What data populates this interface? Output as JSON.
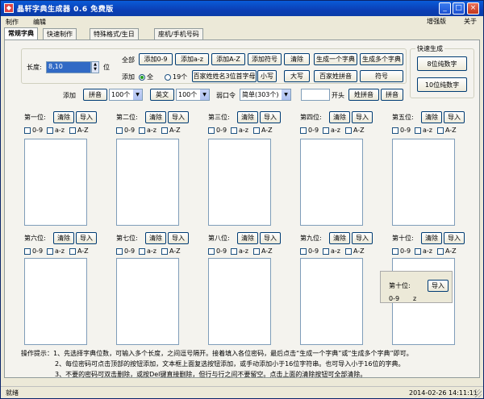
{
  "window": {
    "title": "晶轩字典生成器 0.6 免费版",
    "minimize": "_",
    "maximize": "□",
    "close": "×"
  },
  "menu": {
    "items": [
      "制作",
      "编辑"
    ],
    "right": [
      "增强版",
      "关于"
    ]
  },
  "tabs": [
    "常规字典",
    "快速制作",
    "特殊格式/生日",
    "座机/手机号码"
  ],
  "length": {
    "label": "长度:",
    "value": "8,10",
    "unit": "位"
  },
  "all_label": "全部",
  "add_buttons": [
    "添加0-9",
    "添加a-z",
    "添加A-Z",
    "添加符号",
    "清除"
  ],
  "generate_one": "生成一个字典",
  "generate_multi": "生成多个字典",
  "row2": {
    "add_label": "添加",
    "radio_all": "全",
    "radio_19": "19个",
    "surname_btn": "百家姓姓名3位首字母",
    "small_btn": "小写",
    "big_btn": "大写",
    "surname_pinyin": "百家姓拼音",
    "symbol_btn": "符号"
  },
  "row3": {
    "add_label": "添加",
    "pinyin_btn": "拼音",
    "pinyin_count": "100个",
    "english_btn": "英文",
    "english_count": "100个",
    "weak_label": "弱口令",
    "weak_value": "简单(303个)",
    "start_label": "开头",
    "surname_pinyin_btn": "姓拼音",
    "pinyin2_btn": "拼音"
  },
  "quick": {
    "title": "快速生成",
    "btn8": "8位纯数字",
    "btn10": "10位纯数字"
  },
  "positions": [
    {
      "label": "第一位:"
    },
    {
      "label": "第二位:"
    },
    {
      "label": "第三位:"
    },
    {
      "label": "第四位:"
    },
    {
      "label": "第五位:"
    },
    {
      "label": "第六位:"
    },
    {
      "label": "第七位:"
    },
    {
      "label": "第八位:"
    },
    {
      "label": "第九位:"
    },
    {
      "label": "第十位:"
    }
  ],
  "pos_controls": {
    "clear": "清除",
    "import": "导入",
    "digits": "0-9",
    "lower": "a-z",
    "upper": "A-Z"
  },
  "popup": {
    "label": "第十位:",
    "import": "导入",
    "digits": "0-9",
    "lower": "z"
  },
  "tips": [
    "操作提示：1、先选择字典位数，可输入多个长度，之间逗号隔开。接着填入各位密码，最后点击“生成一个字典”或“生成多个字典”即可。",
    "2、每位密码可点击顶部的按钮添加，文本框上面复选按钮添加，或手动添加小于16位字符串。也可导入小于16位的字典。",
    "3、不要的密码可双击删除，或按Del键直接删除，但行与行之间不要留空。点击上面的清除按钮可全部清除。"
  ],
  "status": {
    "text": "就绪",
    "datetime": "2014-02-26  14:11:11"
  }
}
